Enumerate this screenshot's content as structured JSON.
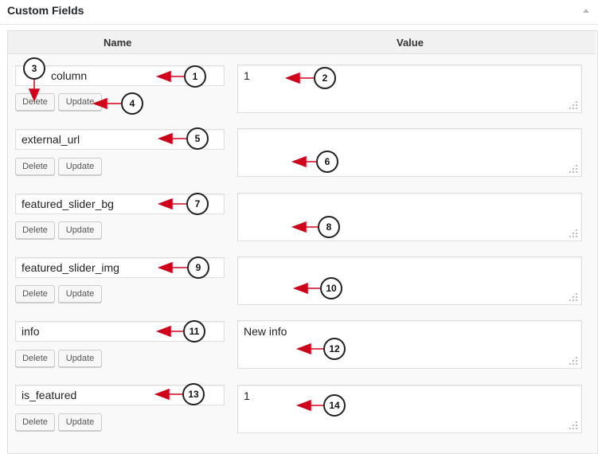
{
  "panel": {
    "title": "Custom Fields"
  },
  "table": {
    "name_header": "Name",
    "value_header": "Value"
  },
  "fields": [
    {
      "name": "column",
      "value": "1"
    },
    {
      "name": "external_url",
      "value": ""
    },
    {
      "name": "featured_slider_bg",
      "value": ""
    },
    {
      "name": "featured_slider_img",
      "value": ""
    },
    {
      "name": "info",
      "value": "New info"
    },
    {
      "name": "is_featured",
      "value": "1"
    }
  ],
  "buttons": {
    "delete": "Delete",
    "update": "Update"
  },
  "callouts": [
    "1",
    "2",
    "3",
    "4",
    "5",
    "6",
    "7",
    "8",
    "9",
    "10",
    "11",
    "12",
    "13",
    "14"
  ],
  "colors": {
    "arrow": "#d0021b",
    "callout_border": "#222222"
  }
}
